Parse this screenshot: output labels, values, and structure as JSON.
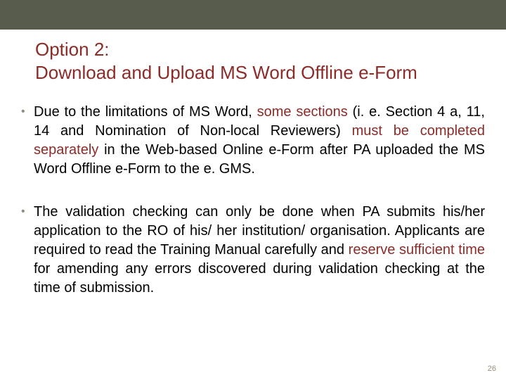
{
  "title": {
    "line1": "Option 2:",
    "line2": "Download and Upload MS Word Offline e-Form"
  },
  "bullets": [
    {
      "parts": [
        {
          "t": "Due to the limitations of MS Word, ",
          "hl": false
        },
        {
          "t": "some sections",
          "hl": true
        },
        {
          "t": " (i. e. Section 4 a, 11, 14 and Nomination of Non-local Reviewers) ",
          "hl": false
        },
        {
          "t": "must be completed separately",
          "hl": true
        },
        {
          "t": " in the Web-based Online e-Form after PA uploaded the MS Word Offline e-Form to the e. GMS.",
          "hl": false
        }
      ]
    },
    {
      "parts": [
        {
          "t": "The validation checking can only be done when PA submits his/her application to the RO of his/ her institution/ organisation.  Applicants are required to read the Training Manual carefully and ",
          "hl": false
        },
        {
          "t": "reserve sufficient time",
          "hl": true
        },
        {
          "t": " for amending any errors discovered during validation checking at the time of submission.",
          "hl": false
        }
      ]
    }
  ],
  "page_number": "26",
  "bullet_marker": "•"
}
